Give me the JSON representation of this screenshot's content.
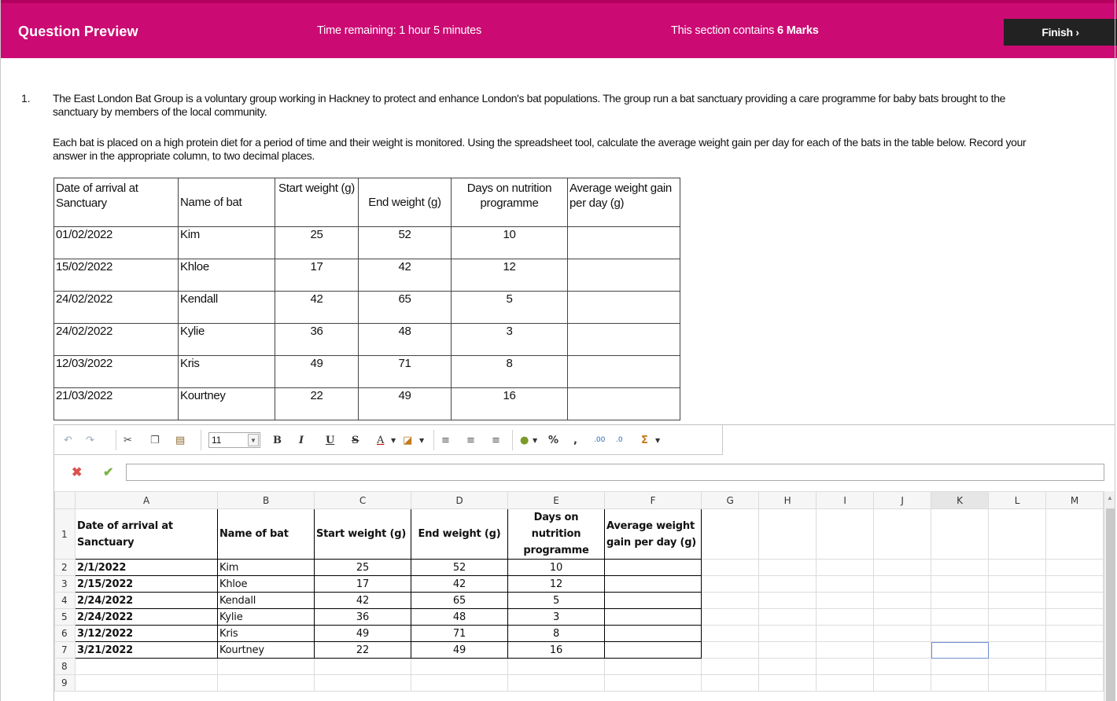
{
  "header": {
    "title": "Question Preview",
    "time_remaining": "Time remaining: 1 hour 5 minutes",
    "marks_prefix": "This section contains",
    "marks_value": "6 Marks",
    "finish_label": "Finish ›"
  },
  "question": {
    "number": "1.",
    "para1": "The East London Bat Group is a voluntary group working in Hackney to protect and enhance London's bat populations. The group run a bat sanctuary providing a care programme for baby bats brought to the sanctuary by members of the local community.",
    "para2": "Each bat is placed on a high protein diet for a period of time and their weight is monitored. Using the spreadsheet tool, calculate the average weight gain per day for each of the bats in the table below. Record your answer in the appropriate column, to two decimal places."
  },
  "table": {
    "headers": [
      "Date of arrival at Sanctuary",
      "Name of bat",
      "Start weight (g)",
      "End weight (g)",
      "Days on nutrition programme",
      "Average weight gain per day (g)"
    ],
    "rows": [
      [
        "01/02/2022",
        "Kim",
        "25",
        "52",
        "10",
        ""
      ],
      [
        "15/02/2022",
        "Khloe",
        "17",
        "42",
        "12",
        ""
      ],
      [
        "24/02/2022",
        "Kendall",
        "42",
        "65",
        "5",
        ""
      ],
      [
        "24/02/2022",
        "Kylie",
        "36",
        "48",
        "3",
        ""
      ],
      [
        "12/03/2022",
        "Kris",
        "49",
        "71",
        "8",
        ""
      ],
      [
        "21/03/2022",
        "Kourtney",
        "22",
        "49",
        "16",
        ""
      ]
    ]
  },
  "toolbar": {
    "font_size": "11",
    "bold": "B",
    "italic": "I",
    "underline": "U",
    "strike": "S",
    "font_color": "A",
    "percent": "%",
    "comma": ",",
    "sum": "Σ"
  },
  "spreadsheet": {
    "columns": [
      "A",
      "B",
      "C",
      "D",
      "E",
      "F",
      "G",
      "H",
      "I",
      "J",
      "K",
      "L",
      "M"
    ],
    "header_row": [
      "Date of arrival at Sanctuary",
      "Name of bat",
      "Start weight (g)",
      "End weight (g)",
      "Days on nutrition programme",
      "Average weight gain per day (g)"
    ],
    "rows": [
      [
        "2/1/2022",
        "Kim",
        "25",
        "52",
        "10",
        ""
      ],
      [
        "2/15/2022",
        "Khloe",
        "17",
        "42",
        "12",
        ""
      ],
      [
        "2/24/2022",
        "Kendall",
        "42",
        "65",
        "5",
        ""
      ],
      [
        "2/24/2022",
        "Kylie",
        "36",
        "48",
        "3",
        ""
      ],
      [
        "3/12/2022",
        "Kris",
        "49",
        "71",
        "8",
        ""
      ],
      [
        "3/21/2022",
        "Kourtney",
        "22",
        "49",
        "16",
        ""
      ]
    ],
    "row_numbers": [
      "1",
      "2",
      "3",
      "4",
      "5",
      "6",
      "7",
      "8",
      "9"
    ]
  }
}
